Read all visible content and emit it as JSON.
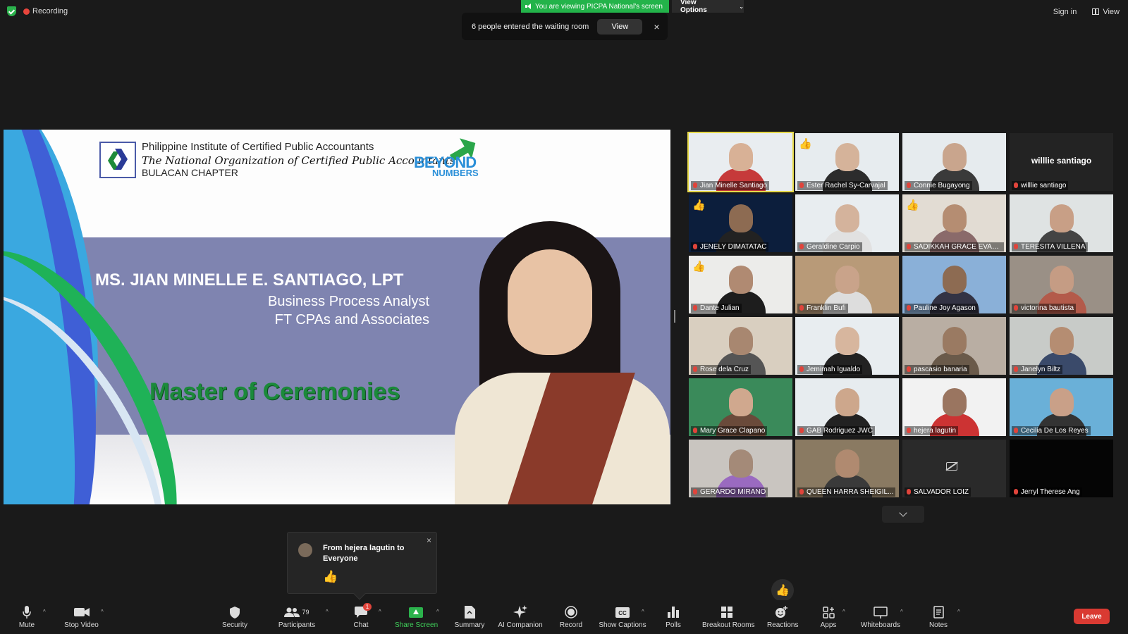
{
  "top": {
    "recording": "Recording",
    "viewing_banner": "You are viewing PICPA National's screen",
    "view_options": "View Options",
    "sign_in": "Sign in",
    "view": "View"
  },
  "notice": {
    "text": "6 people entered the waiting room",
    "button": "View",
    "close": "×"
  },
  "slide": {
    "org_line1": "Philippine Institute of Certified Public Accountants",
    "org_line2": "The National Organization of Certified Public Accountants",
    "org_line3": "BULACAN CHAPTER",
    "logo_word1": "BEYOND",
    "logo_word2": "NUMBERS",
    "speaker_name": "MS. JIAN MINELLE E. SANTIAGO, LPT",
    "speaker_role": "Business Process Analyst",
    "speaker_company": "FT CPAs and Associates",
    "title": "Master of Ceremonies"
  },
  "participants": [
    {
      "name": "Jian Minelle Santiago",
      "active": true,
      "thumb": "",
      "camoff": false,
      "bg": "#e9edf0",
      "skin": "#d8b196",
      "shirt": "#c63a3a"
    },
    {
      "name": "Ester Rachel Sy-Carvajal",
      "active": false,
      "thumb": "👍",
      "camoff": false,
      "bg": "#e7ecef",
      "skin": "#d5b39a",
      "shirt": "#2c2c2c"
    },
    {
      "name": "Connie Bugayong",
      "active": false,
      "thumb": "",
      "camoff": false,
      "bg": "#e6ebee",
      "skin": "#c9a58d",
      "shirt": "#3a3a3a"
    },
    {
      "name": "willlie santiago",
      "active": false,
      "thumb": "",
      "camoff": false,
      "bg": "#232323",
      "skin": "",
      "shirt": "",
      "bigname": "willlie santiago"
    },
    {
      "name": "JENELY DIMATATAC",
      "active": false,
      "thumb": "👍",
      "camoff": false,
      "bg": "#0c1e3c",
      "skin": "#8d6b52",
      "shirt": "#222"
    },
    {
      "name": "Geraldine Carpio",
      "active": false,
      "thumb": "",
      "camoff": false,
      "bg": "#e8edf0",
      "skin": "#d4b39c",
      "shirt": "#e1e1e1"
    },
    {
      "name": "SADIKKAH GRACE EVAN...",
      "active": false,
      "thumb": "👍",
      "camoff": false,
      "bg": "#e2dcd3",
      "skin": "#b58d72",
      "shirt": "#8a6a6a"
    },
    {
      "name": "TERESITA VILLENA",
      "active": false,
      "thumb": "",
      "camoff": false,
      "bg": "#dfe3e3",
      "skin": "#c89f86",
      "shirt": "#444"
    },
    {
      "name": "Dante Julian",
      "active": false,
      "thumb": "👍",
      "camoff": false,
      "bg": "#ececea",
      "skin": "#b08a72",
      "shirt": "#1d1d1d"
    },
    {
      "name": "Franklin Bufi",
      "active": false,
      "thumb": "",
      "camoff": false,
      "bg": "#b89a78",
      "skin": "#c9a38a",
      "shirt": "#ddd"
    },
    {
      "name": "Pauline Joy Agason",
      "active": false,
      "thumb": "",
      "camoff": false,
      "bg": "#8ab0d8",
      "skin": "#8d6b52",
      "shirt": "#334"
    },
    {
      "name": "victorina bautista",
      "active": false,
      "thumb": "",
      "camoff": false,
      "bg": "#9a9086",
      "skin": "#c59c84",
      "shirt": "#b35a4a"
    },
    {
      "name": "Rose dela Cruz",
      "active": false,
      "thumb": "",
      "camoff": false,
      "bg": "#d9cfc0",
      "skin": "#a88770",
      "shirt": "#555"
    },
    {
      "name": "Jemimah Igualdo",
      "active": false,
      "thumb": "",
      "camoff": false,
      "bg": "#e8edf0",
      "skin": "#d7b69e",
      "shirt": "#222"
    },
    {
      "name": "pascasio banaria",
      "active": false,
      "thumb": "",
      "camoff": false,
      "bg": "#b9aea3",
      "skin": "#9a7a62",
      "shirt": "#6a5a4a"
    },
    {
      "name": "Janelyn Biltz",
      "active": false,
      "thumb": "",
      "camoff": false,
      "bg": "#c8cbc8",
      "skin": "#b58d72",
      "shirt": "#3a4a6a"
    },
    {
      "name": "Mary Grace Clapano",
      "active": false,
      "thumb": "",
      "camoff": false,
      "bg": "#3a8a5a",
      "skin": "#d0a88e",
      "shirt": "#6a4a3a"
    },
    {
      "name": "GAB Rodriguez JWC",
      "active": false,
      "thumb": "",
      "camoff": false,
      "bg": "#e7ecef",
      "skin": "#cda78c",
      "shirt": "#222"
    },
    {
      "name": "hejera lagutin",
      "active": false,
      "thumb": "",
      "camoff": false,
      "bg": "#f2f2f2",
      "skin": "#9a7560",
      "shirt": "#c33"
    },
    {
      "name": "Cecilia De Los Reyes",
      "active": false,
      "thumb": "",
      "camoff": false,
      "bg": "#6ab0d8",
      "skin": "#c9a088",
      "shirt": "#333"
    },
    {
      "name": "GERARDO MIRANO",
      "active": false,
      "thumb": "",
      "camoff": false,
      "bg": "#c9c5c0",
      "skin": "#a48a78",
      "shirt": "#9a6ac0"
    },
    {
      "name": "QUEEN HARRA SHEIGIL...",
      "active": false,
      "thumb": "",
      "camoff": false,
      "bg": "#8a7a62",
      "skin": "#b08a70",
      "shirt": "#3a3a3a"
    },
    {
      "name": "SALVADOR LOIZ",
      "active": false,
      "thumb": "",
      "camoff": true,
      "bg": "#2a2a2a",
      "skin": "",
      "shirt": ""
    },
    {
      "name": "Jerryl Therese Ang",
      "active": false,
      "thumb": "",
      "camoff": false,
      "bg": "#050505",
      "skin": "",
      "shirt": ""
    }
  ],
  "chat_popup": {
    "from": "From hejera lagutin to Everyone",
    "message": "👍",
    "close": "×"
  },
  "reaction": "👍",
  "toolbar": {
    "mute": "Mute",
    "stop_video": "Stop Video",
    "security": "Security",
    "participants": "Participants",
    "participants_count": "79",
    "chat": "Chat",
    "chat_badge": "1",
    "share_screen": "Share Screen",
    "summary": "Summary",
    "ai_companion": "AI Companion",
    "record": "Record",
    "show_captions": "Show Captions",
    "polls": "Polls",
    "breakout_rooms": "Breakout Rooms",
    "reactions": "Reactions",
    "apps": "Apps",
    "whiteboards": "Whiteboards",
    "notes": "Notes",
    "leave": "Leave"
  },
  "icons": {
    "mute": "microphone-icon",
    "video": "video-camera-icon",
    "security": "shield-icon",
    "participants": "people-icon",
    "chat": "chat-bubble-icon",
    "share": "share-screen-icon",
    "summary": "document-icon",
    "ai": "sparkle-icon",
    "record": "record-icon",
    "captions": "cc-icon",
    "polls": "bar-chart-icon",
    "breakout": "grid-icon",
    "reactions": "smiley-icon",
    "apps": "apps-icon",
    "whiteboards": "whiteboard-icon",
    "notes": "notes-icon"
  }
}
